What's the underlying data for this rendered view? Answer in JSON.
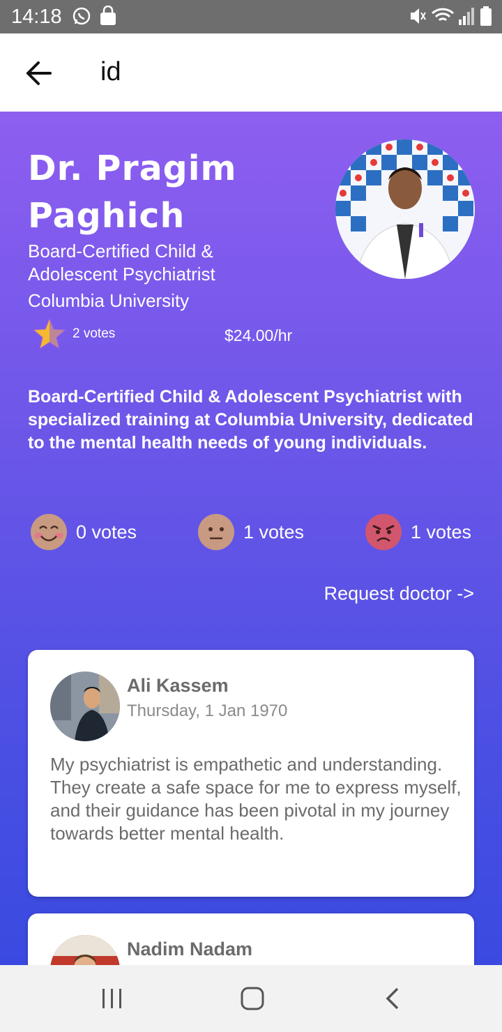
{
  "status": {
    "time": "14:18",
    "icons": [
      "whatsapp-icon",
      "bag-icon",
      "mute-icon",
      "wifi-icon",
      "signal-icon",
      "battery-icon"
    ]
  },
  "appbar": {
    "title": "id",
    "back_icon": "arrow-left-icon"
  },
  "doctor": {
    "name": "Dr. Pragim Paghich",
    "title": "Board-Certified Child & Adolescent Psychiatrist",
    "school": "Columbia University",
    "votes": "2 votes",
    "price": "$24.00/hr",
    "bio": "Board-Certified Child & Adolescent Psychiatrist with specialized training at Columbia University, dedicated to the mental health needs of young individuals."
  },
  "moods": [
    {
      "icon": "happy-face-icon",
      "label": "0 votes"
    },
    {
      "icon": "neutral-face-icon",
      "label": "1 votes"
    },
    {
      "icon": "angry-face-icon",
      "label": "1 votes"
    }
  ],
  "request_label": "Request doctor ->",
  "reviews": [
    {
      "name": "Ali Kassem",
      "date": "Thursday, 1 Jan 1970",
      "text": "My psychiatrist is empathetic and understanding. They create a safe space for me to express myself, and their guidance has been pivotal in my journey towards better mental health."
    },
    {
      "name": "Nadim Nadam"
    }
  ],
  "colors": {
    "gradient_top": "#8e5ef0",
    "gradient_bottom": "#3a4ae0",
    "star": "#f5b82e"
  }
}
